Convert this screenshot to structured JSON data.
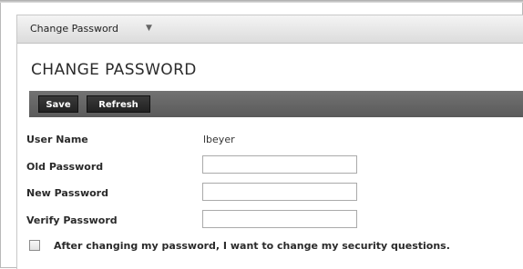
{
  "tab": {
    "title": "Change Password",
    "chevron_icon": "chevron-down-icon"
  },
  "page": {
    "title": "CHANGE PASSWORD"
  },
  "toolbar": {
    "save_label": "Save",
    "refresh_label": "Refresh"
  },
  "form": {
    "user_name_label": "User Name",
    "user_name_value": "lbeyer",
    "old_password_label": "Old Password",
    "old_password_value": "",
    "new_password_label": "New Password",
    "new_password_value": "",
    "verify_password_label": "Verify Password",
    "verify_password_value": "",
    "security_questions_checked": false,
    "security_questions_label": "After changing my password, I want to change my security questions."
  },
  "colors": {
    "toolbar_bg": "#656565",
    "button_bg": "#2a2a2a",
    "label_text": "#2a2a2a"
  }
}
